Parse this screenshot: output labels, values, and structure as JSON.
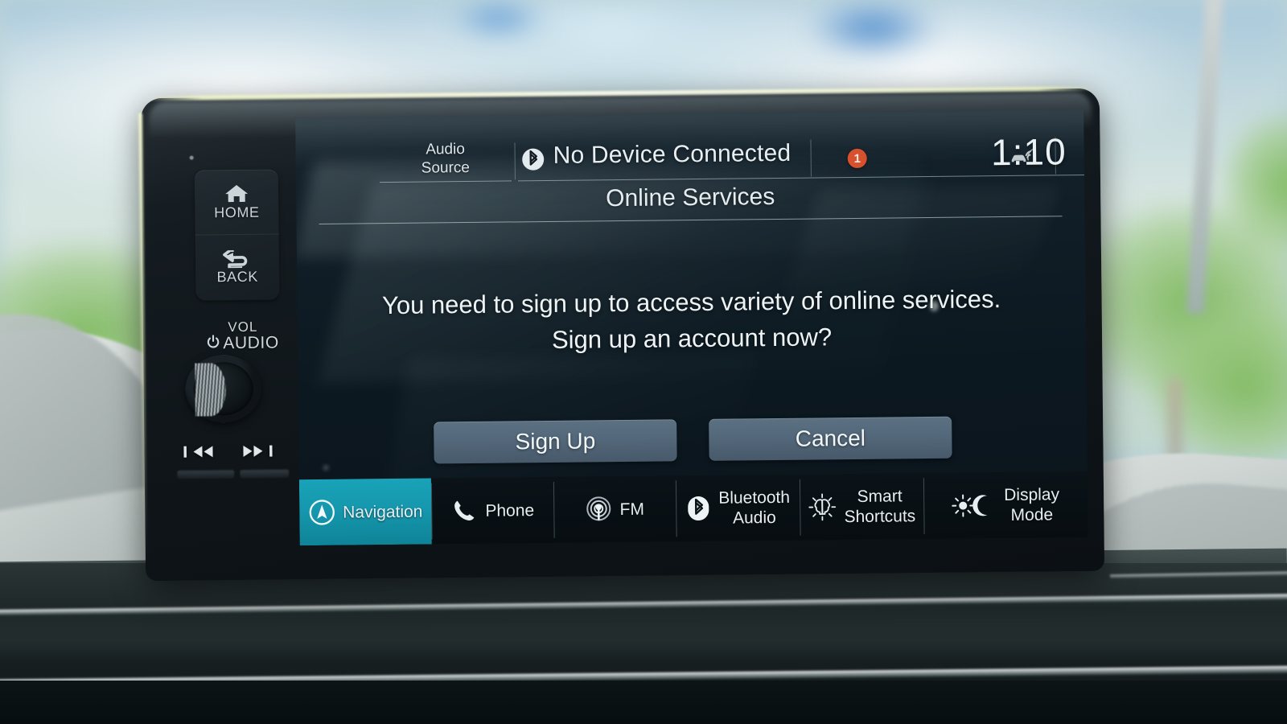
{
  "device": {
    "hard_buttons": [
      {
        "name": "home",
        "label": "HOME",
        "icon": "home-icon"
      },
      {
        "name": "back",
        "label": "BACK",
        "icon": "back-arrow-icon"
      }
    ],
    "volume_knob": {
      "top_label": "VOL",
      "bottom_label": "AUDIO",
      "power_icon": "power-icon"
    },
    "seek_buttons": [
      {
        "name": "previous-track",
        "icon": "skip-back-icon"
      },
      {
        "name": "next-track",
        "icon": "skip-forward-icon"
      }
    ]
  },
  "status_bar": {
    "audio_source_line1": "Audio",
    "audio_source_line2": "Source",
    "bluetooth_icon": "bluetooth-icon",
    "device_status": "No Device Connected",
    "notification_count": "1",
    "notification_color": "#d8512f",
    "connectivity_icon": "car-wifi-icon",
    "clock": "1:10"
  },
  "dialog": {
    "title": "Online Services",
    "message_line1": "You need to sign up to access variety of online services.",
    "message_line2": "Sign up an account now?",
    "buttons": [
      {
        "name": "sign-up",
        "label": "Sign Up"
      },
      {
        "name": "cancel",
        "label": "Cancel"
      }
    ]
  },
  "taskbar": {
    "active_color": "#1596ac",
    "items": [
      {
        "name": "navigation",
        "label": "Navigation",
        "label2": "",
        "icon": "navigation-arrow-icon",
        "active": true
      },
      {
        "name": "phone",
        "label": "Phone",
        "label2": "",
        "icon": "phone-handset-icon",
        "active": false
      },
      {
        "name": "fm",
        "label": "FM",
        "label2": "",
        "icon": "radio-broadcast-icon",
        "active": false
      },
      {
        "name": "bluetooth-audio",
        "label": "Bluetooth",
        "label2": "Audio",
        "icon": "bluetooth-icon",
        "active": false
      },
      {
        "name": "smart-shortcuts",
        "label": "Smart",
        "label2": "Shortcuts",
        "icon": "brain-idea-icon",
        "active": false
      },
      {
        "name": "display-mode",
        "label": "Display",
        "label2": "Mode",
        "icon": "sun-moon-icon",
        "active": false
      }
    ]
  }
}
